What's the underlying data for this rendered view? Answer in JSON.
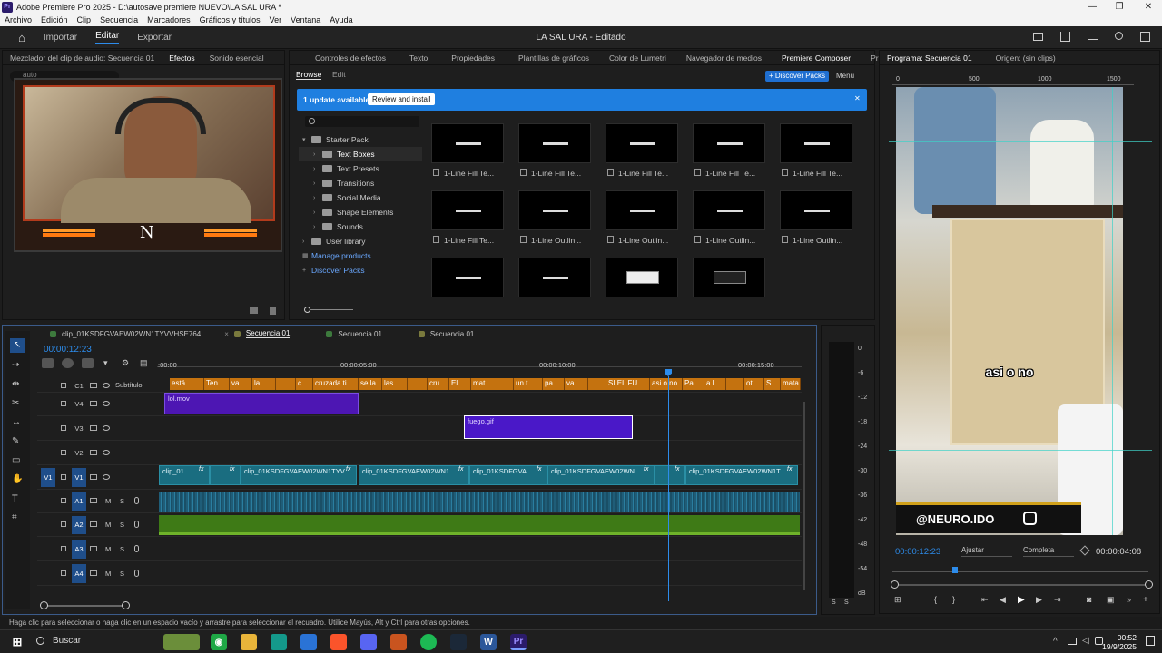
{
  "window": {
    "title": "Adobe Premiere Pro 2025 - D:\\autosave premiere NUEVO\\LA SAL URA *",
    "minimize": "—",
    "restore": "❐",
    "close": "✕"
  },
  "menu": [
    "Archivo",
    "Edición",
    "Clip",
    "Secuencia",
    "Marcadores",
    "Gráficos y títulos",
    "Ver",
    "Ventana",
    "Ayuda"
  ],
  "workspace": {
    "home": "⌂",
    "tabs": [
      "Importar",
      "Editar",
      "Exportar"
    ],
    "active": "Editar",
    "project_title": "LA SAL URA - Editado"
  },
  "left_panel": {
    "tabs": [
      "Mezclador del clip de audio: Secuencia 01",
      "Efectos",
      "Sonido esencial"
    ],
    "active": "Efectos",
    "search_value": "auto"
  },
  "center_panel": {
    "tabs": [
      "Controles de efectos",
      "Texto",
      "Propiedades",
      "Plantillas de gráficos",
      "Color de Lumetri",
      "Navegador de medios",
      "Premiere Composer",
      "Proyecto:"
    ],
    "active": "Premiere Composer",
    "subtabs": [
      "Browse",
      "Edit"
    ],
    "discover_btn": "+ Discover Packs",
    "menu_btn": "Menu",
    "update": {
      "text": "1 update available",
      "button": "Review and install",
      "close": "✕"
    },
    "tree": [
      {
        "label": "Starter Pack",
        "level": 0,
        "open": true
      },
      {
        "label": "Text Boxes",
        "level": 1,
        "selected": true
      },
      {
        "label": "Text Presets",
        "level": 1
      },
      {
        "label": "Transitions",
        "level": 1
      },
      {
        "label": "Social Media",
        "level": 1
      },
      {
        "label": "Shape Elements",
        "level": 1
      },
      {
        "label": "Sounds",
        "level": 1
      },
      {
        "label": "User library",
        "level": 0
      },
      {
        "label": "Manage products",
        "level": 0,
        "link": true
      },
      {
        "label": "Discover Packs",
        "level": 0,
        "link": true
      }
    ],
    "grid": [
      "1-Line Fill Te...",
      "1-Line Fill Te...",
      "1-Line Fill Te...",
      "1-Line Fill Te...",
      "1-Line Fill Te...",
      "1-Line Fill Te...",
      "1-Line Outlin...",
      "1-Line Outlin...",
      "1-Line Outlin...",
      "1-Line Outlin...",
      "",
      "",
      "",
      "",
      ""
    ]
  },
  "program": {
    "tabs": [
      "Programa: Secuencia 01",
      "Origen: (sin clips)"
    ],
    "ruler": [
      "0",
      "500",
      "1000",
      "1500"
    ],
    "caption": "asi o no",
    "handle": "@NEURO.IDO",
    "timecode": "00:00:12:23",
    "fit": "Ajustar",
    "quality": "Completa",
    "duration": "00:00:04:08"
  },
  "timeline": {
    "tabs": [
      "clip_01KSDFGVAEW02WN1TYVVHSE764",
      "Secuencia 01",
      "Secuencia 01",
      "Secuencia 01"
    ],
    "active_index": 1,
    "timecode": "00:00:12:23",
    "ruler": [
      ":00:00",
      "00:00:05:00",
      "00:00:10:00",
      "00:00:15:00"
    ],
    "subtitle_label": "Subtítulo",
    "tracks": [
      {
        "id": "C1",
        "label": "C1"
      },
      {
        "id": "V4",
        "label": "V4"
      },
      {
        "id": "V3",
        "label": "V3"
      },
      {
        "id": "V2",
        "label": "V2"
      },
      {
        "id": "V1",
        "label": "V1",
        "src": "V1"
      },
      {
        "id": "A1",
        "label": "A1",
        "m": "M",
        "s": "S"
      },
      {
        "id": "A2",
        "label": "A2",
        "m": "M",
        "s": "S"
      },
      {
        "id": "A3",
        "label": "A3",
        "m": "M",
        "s": "S"
      },
      {
        "id": "A4",
        "label": "A4",
        "m": "M",
        "s": "S"
      }
    ],
    "captions": [
      "está...",
      "Ten...",
      "va...",
      "la ...",
      "...",
      "c...",
      "cruzada ti...",
      "se la...",
      "las...",
      "...",
      "cru...",
      "El...",
      "mat...",
      "...",
      "un t...",
      "pa ...",
      "va ...",
      "...",
      "SI EL FU...",
      "asi o no",
      "Pa...",
      "a l...",
      "...",
      "ot...",
      "S...",
      "mata t"
    ],
    "v4_clip": "lol.mov",
    "v3_clip": "fuego.gif",
    "v1_clips": [
      "clip_01...",
      "clip_01KSDFGVAEW02WN1TYV...",
      "clip_01KSDFGVAEW02WN1...",
      "clip_01KSDFGVA...",
      "clip_01KSDFGVAEW02WN...",
      "clip_01KSDFGVAEW02WN1T..."
    ],
    "fx": "fx"
  },
  "meter": {
    "scale": [
      "0",
      "-6",
      "-12",
      "-18",
      "-24",
      "-30",
      "-36",
      "-42",
      "-48",
      "-54",
      "dB"
    ],
    "s": "S"
  },
  "status": "Haga clic para seleccionar o haga clic en un espacio vacío y arrastre para seleccionar el recuadro. Utilice Mayús, Alt y Ctrl para otras opciones.",
  "taskbar": {
    "search": "Buscar",
    "time": "00:52",
    "date": "19/9/2025"
  }
}
